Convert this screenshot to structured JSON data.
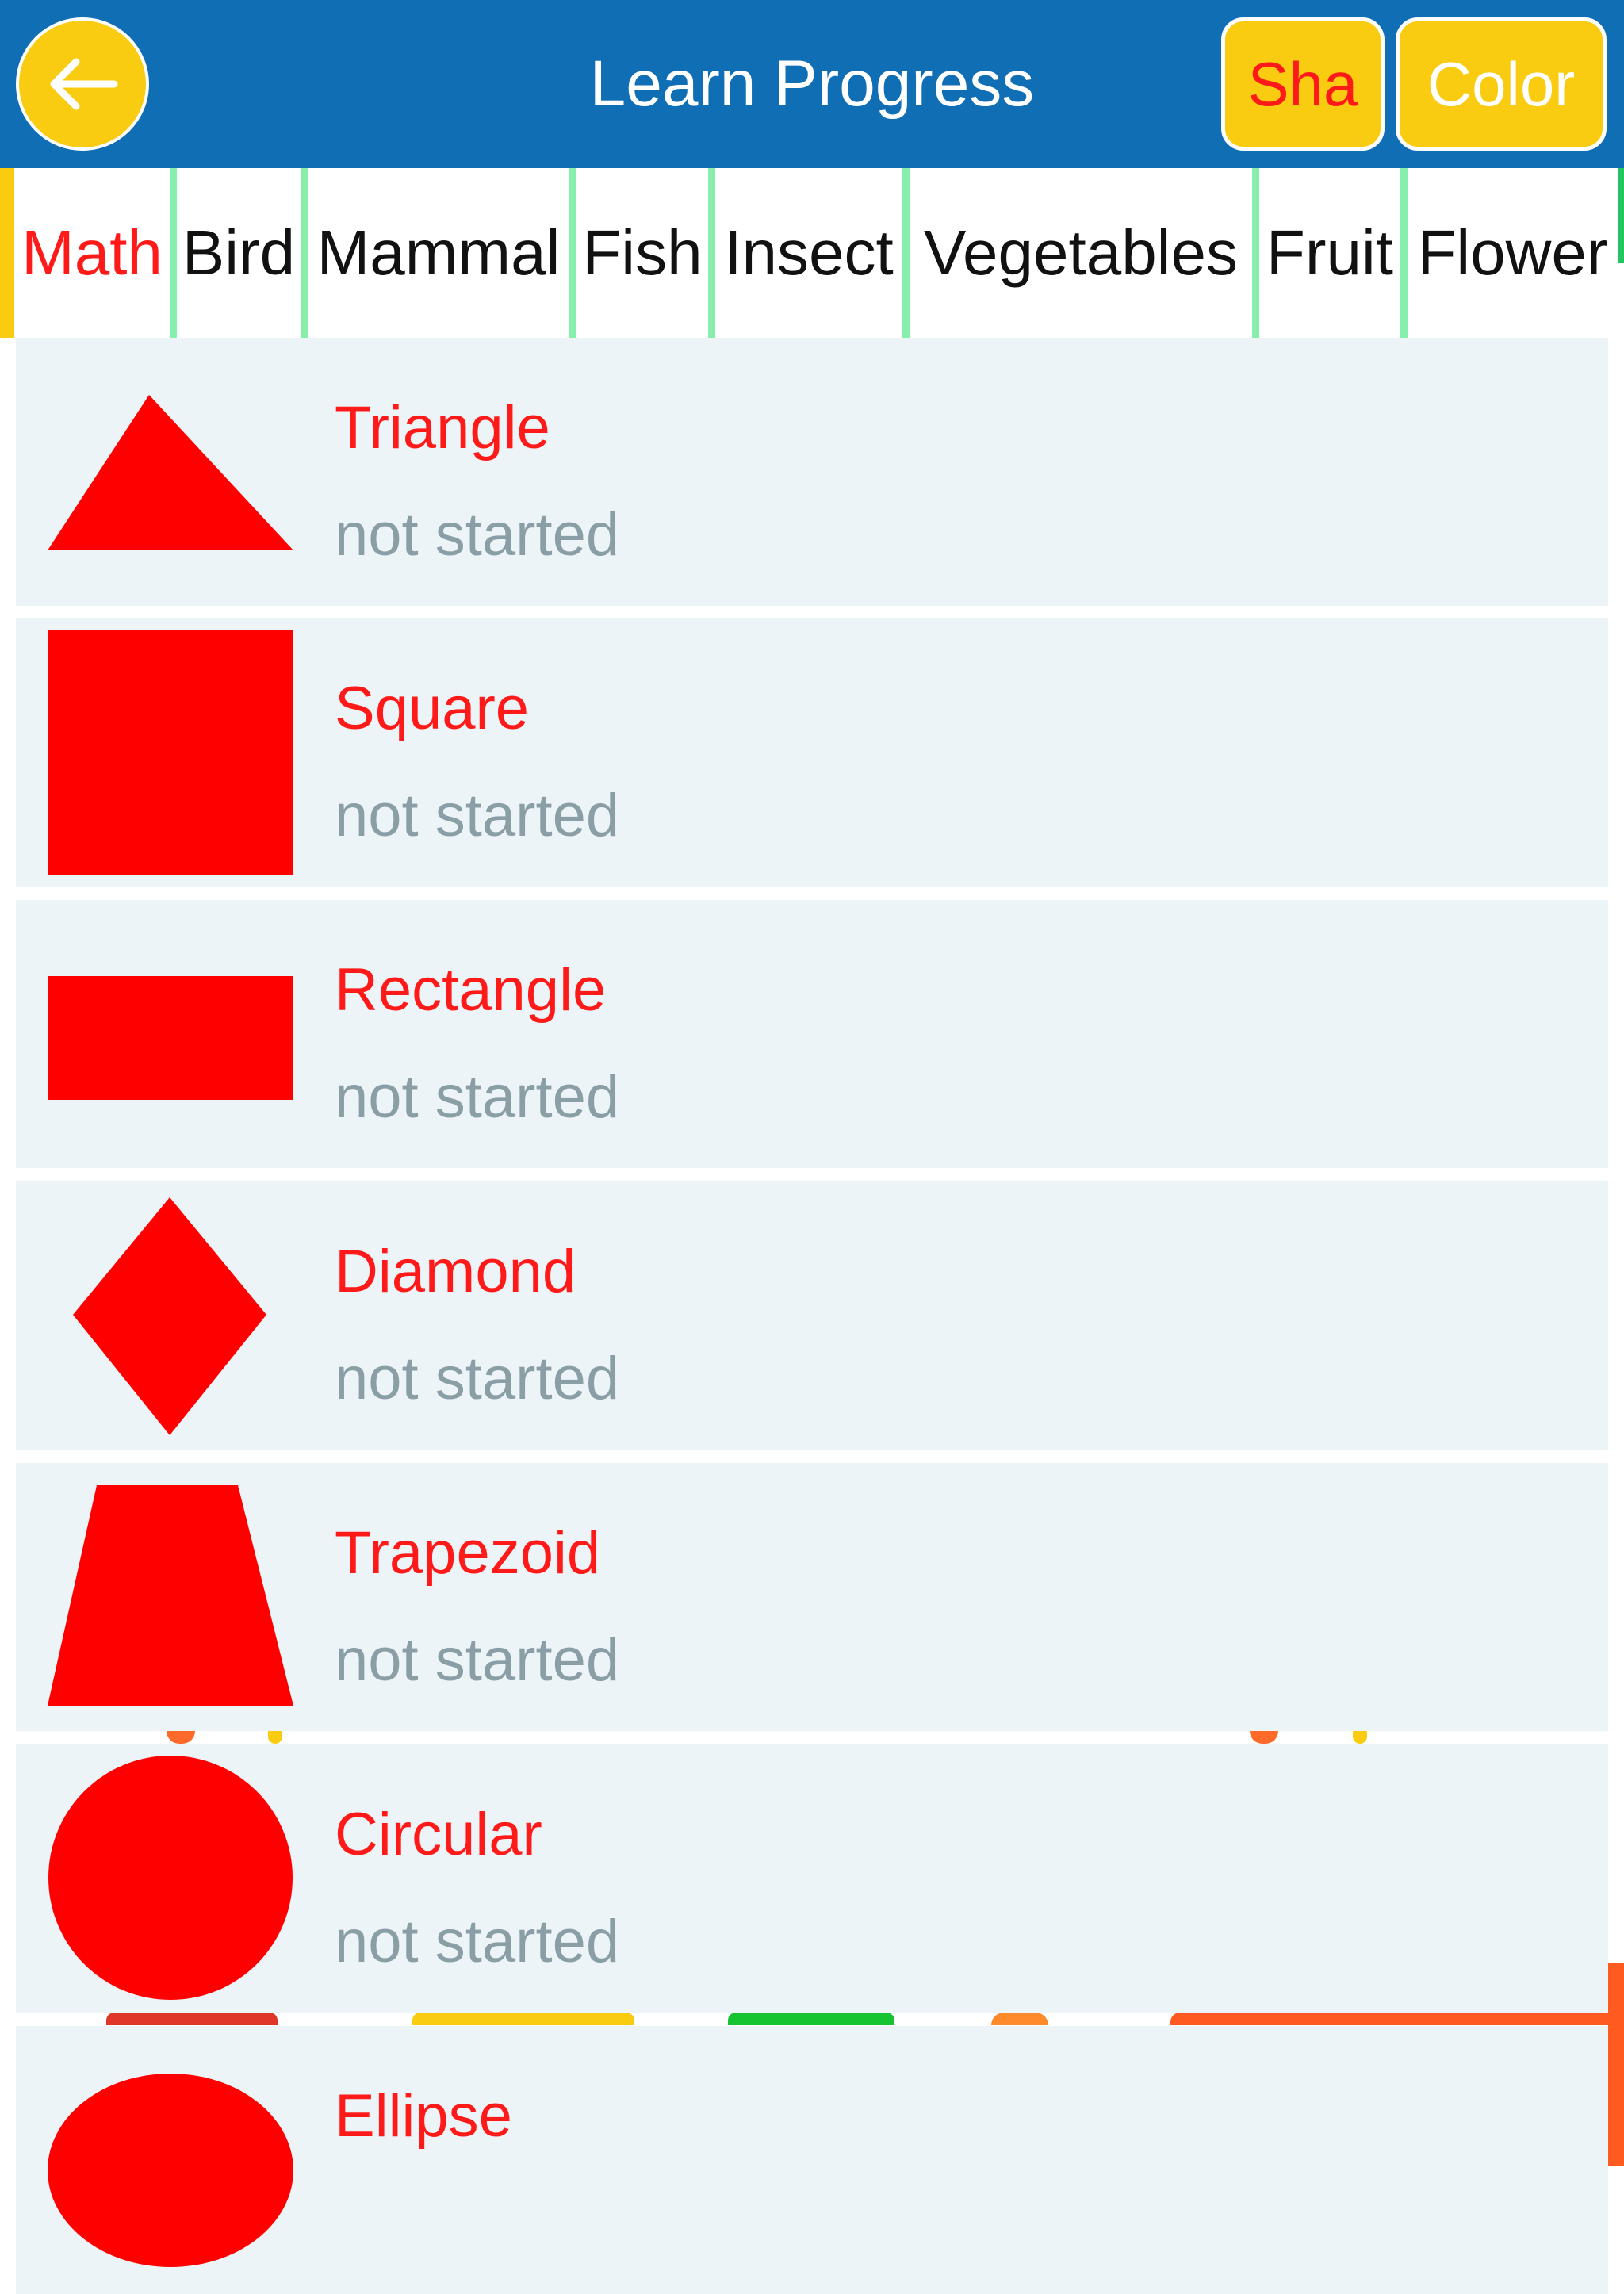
{
  "header": {
    "title": "Learn Progress",
    "back_icon": "arrow-left-icon",
    "shape_button": "Sha",
    "color_button": "Color"
  },
  "tabs": [
    {
      "label": "Math",
      "active": true
    },
    {
      "label": "Bird",
      "active": false
    },
    {
      "label": "Mammal",
      "active": false
    },
    {
      "label": "Fish",
      "active": false
    },
    {
      "label": "Insect",
      "active": false
    },
    {
      "label": "Vegetables",
      "active": false
    },
    {
      "label": "Fruit",
      "active": false
    },
    {
      "label": "Flower",
      "active": false
    }
  ],
  "items": [
    {
      "name": "Triangle",
      "status": "not started",
      "shape": "triangle"
    },
    {
      "name": "Square",
      "status": "not started",
      "shape": "square"
    },
    {
      "name": "Rectangle",
      "status": "not started",
      "shape": "rectangle"
    },
    {
      "name": "Diamond",
      "status": "not started",
      "shape": "diamond"
    },
    {
      "name": "Trapezoid",
      "status": "not started",
      "shape": "trapezoid"
    },
    {
      "name": "Circular",
      "status": "not started",
      "shape": "circle"
    },
    {
      "name": "Ellipse",
      "status": "",
      "shape": "ellipse"
    }
  ],
  "colors": {
    "header_bg": "#0f6eb4",
    "button_yellow": "#f9cc11",
    "shape_red": "#ff0000",
    "label_red": "#ff1a1a",
    "status_gray": "#8a9ea6",
    "row_bg": "#edf4f8",
    "tab_separator": "#86efac"
  }
}
